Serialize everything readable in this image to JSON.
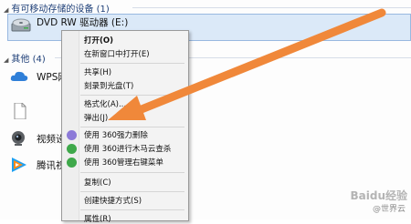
{
  "sections": {
    "removable_header": "有可移动存储的设备 (1)",
    "other_header": "其他 (4)"
  },
  "drive": {
    "label": "DVD RW 驱动器 (E:)",
    "icon": "dvd-drive-icon"
  },
  "other_items": [
    {
      "label": "WPS网",
      "icon": "cloud-icon"
    },
    {
      "label": "",
      "icon": "file-icon"
    },
    {
      "label": "视频设",
      "icon": "webcam-icon"
    },
    {
      "label": "腾讯视",
      "icon": "tencent-video-icon"
    }
  ],
  "context_menu": {
    "items": [
      {
        "label": "打开(O)"
      },
      {
        "label": "在新窗口中打开(E)"
      },
      {
        "label": "共享(H)"
      },
      {
        "label": "刻录到光盘(T)"
      },
      {
        "label": "格式化(A)..."
      },
      {
        "label": "弹出(J)"
      },
      {
        "label": "使用 360强力删除",
        "icon": "360-delete-icon"
      },
      {
        "label": "使用 360进行木马云查杀",
        "icon": "360-shield-icon"
      },
      {
        "label": "使用 360管理右键菜单",
        "icon": "360-manage-icon"
      },
      {
        "label": "复制(C)"
      },
      {
        "label": "创建快捷方式(S)"
      },
      {
        "label": "属性(R)"
      }
    ]
  },
  "watermark": {
    "brand": "Baidu经验",
    "credit": "@世界云"
  },
  "colors": {
    "header_text": "#1e3f78",
    "selection": "#dbe9f8",
    "arrow": "#f0883a"
  }
}
